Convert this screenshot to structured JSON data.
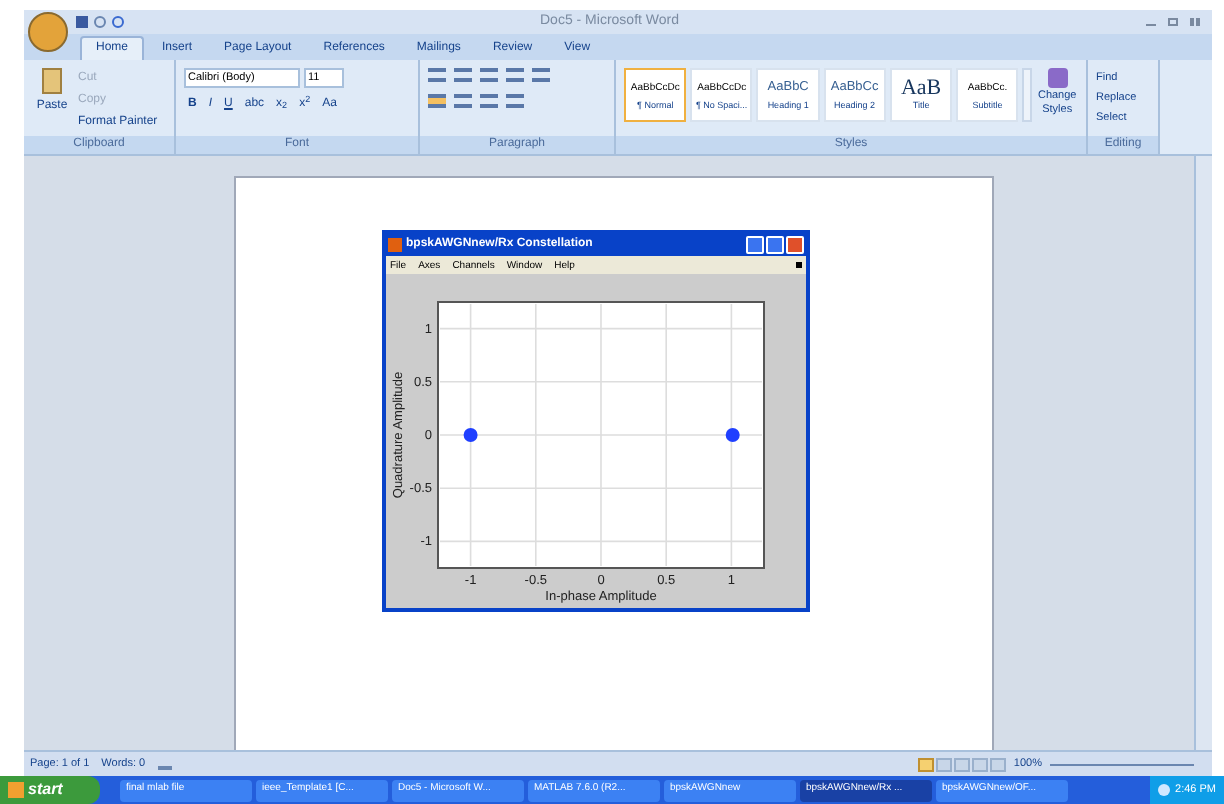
{
  "window": {
    "title": "Doc5 - Microsoft Word"
  },
  "tabs": [
    {
      "label": "Home",
      "selected": true
    },
    {
      "label": "Insert",
      "selected": false
    },
    {
      "label": "Page Layout",
      "selected": false
    },
    {
      "label": "References",
      "selected": false
    },
    {
      "label": "Mailings",
      "selected": false
    },
    {
      "label": "Review",
      "selected": false
    },
    {
      "label": "View",
      "selected": false
    }
  ],
  "clipboard": {
    "paste": "Paste",
    "items": [
      "Cut",
      "Copy",
      "Format Painter"
    ],
    "label": "Clipboard"
  },
  "font": {
    "name": "Calibri (Body)",
    "size": "11",
    "buttons": [
      "B",
      "I",
      "U",
      "abc",
      "x$_{2}$",
      "x$^{2}$",
      "Aa"
    ],
    "label": "Font"
  },
  "paragraph": {
    "label": "Paragraph"
  },
  "styles": {
    "items": [
      {
        "sample": "AaBbCcDc",
        "name": "¶ Normal",
        "selected": true
      },
      {
        "sample": "AaBbCcDc",
        "name": "¶ No Spaci...",
        "selected": false
      },
      {
        "sample": "AaBbC",
        "name": "Heading 1",
        "selected": false
      },
      {
        "sample": "AaBbCc",
        "name": "Heading 2",
        "selected": false
      },
      {
        "sample": "AaB",
        "name": "Title",
        "selected": false
      },
      {
        "sample": "AaBbCc.",
        "name": "Subtitle",
        "selected": false
      }
    ],
    "change": "Change Styles",
    "label": "Styles"
  },
  "editing": {
    "items": [
      "Find",
      "Replace",
      "Select"
    ],
    "label": "Editing"
  },
  "scope": {
    "title": "bpskAWGNnew/Rx Constellation",
    "menu": [
      "File",
      "Axes",
      "Channels",
      "Window",
      "Help"
    ],
    "chart_data": {
      "type": "scatter",
      "xlabel": "In-phase Amplitude",
      "ylabel": "Quadrature Amplitude",
      "xlim": [
        -1.25,
        1.25
      ],
      "ylim": [
        -1.25,
        1.25
      ],
      "xticks": [
        -1,
        -0.5,
        0,
        0.5,
        1
      ],
      "yticks": [
        -1,
        -0.5,
        0,
        0.5,
        1
      ],
      "grid": true,
      "x": [
        -1.0,
        1.01
      ],
      "series": [
        {
          "color": "#1f3fff",
          "values": [
            0.0,
            0.0
          ]
        }
      ]
    }
  },
  "status": {
    "page": "Page: 1 of 1",
    "words": "Words: 0",
    "zoom": "100%"
  },
  "taskbar": {
    "start": "start",
    "items": [
      {
        "label": "final mlab file",
        "selected": false
      },
      {
        "label": "ieee_Template1 [C...",
        "selected": false
      },
      {
        "label": "Doc5 - Microsoft W...",
        "selected": false
      },
      {
        "label": "MATLAB 7.6.0 (R2...",
        "selected": false
      },
      {
        "label": "bpskAWGNnew",
        "selected": false
      },
      {
        "label": "bpskAWGNnew/Rx ...",
        "selected": true
      },
      {
        "label": "bpskAWGNnew/OF...",
        "selected": false
      }
    ],
    "time": "2:46 PM"
  }
}
